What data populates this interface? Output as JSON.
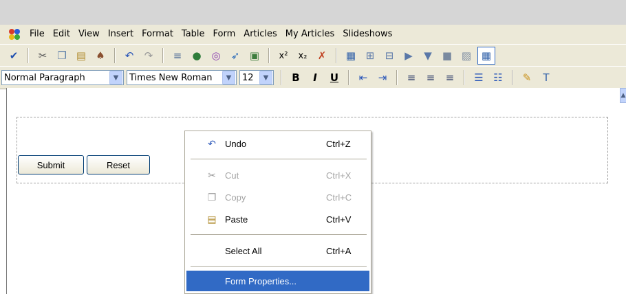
{
  "menu": {
    "items": [
      "File",
      "Edit",
      "View",
      "Insert",
      "Format",
      "Table",
      "Form",
      "Articles",
      "My Articles",
      "Slideshows"
    ]
  },
  "toolbar1": {
    "icons": [
      {
        "name": "spellcheck-icon",
        "glyph": "✔",
        "color": "#2050b0"
      },
      {
        "sep": true
      },
      {
        "name": "cut-icon",
        "glyph": "✂",
        "color": "#555555"
      },
      {
        "name": "copy-icon",
        "glyph": "❐",
        "color": "#5a7da8"
      },
      {
        "name": "paste-icon",
        "glyph": "▤",
        "color": "#b08a2c"
      },
      {
        "name": "find-icon",
        "glyph": "♠",
        "color": "#8a5030"
      },
      {
        "sep": true
      },
      {
        "name": "undo-icon",
        "glyph": "↶",
        "color": "#2a56b8"
      },
      {
        "name": "redo-icon",
        "glyph": "↷",
        "color": "#9a9a9a"
      },
      {
        "sep": true
      },
      {
        "name": "horizontal-rule-icon",
        "glyph": "≡",
        "color": "#406090"
      },
      {
        "name": "insert-link-icon",
        "glyph": "●",
        "color": "#2f7d3a"
      },
      {
        "name": "insert-media-icon",
        "glyph": "◎",
        "color": "#8a3ab0"
      },
      {
        "name": "insert-bookmark-icon",
        "glyph": "➶",
        "color": "#2a6ab8"
      },
      {
        "name": "insert-image-icon",
        "glyph": "▣",
        "color": "#3d7d3d"
      },
      {
        "sep": true
      },
      {
        "name": "superscript-icon",
        "glyph": "x²",
        "color": "#000000"
      },
      {
        "name": "subscript-icon",
        "glyph": "x₂",
        "color": "#000000"
      },
      {
        "name": "clear-formatting-icon",
        "glyph": "✗",
        "color": "#c04020"
      },
      {
        "sep": true
      },
      {
        "name": "insert-table-icon",
        "glyph": "▦",
        "color": "#3060a8"
      },
      {
        "name": "insert-row-icon",
        "glyph": "⊞",
        "color": "#5a78a8"
      },
      {
        "name": "insert-column-icon",
        "glyph": "⊟",
        "color": "#5a78a8"
      },
      {
        "name": "merge-cells-icon",
        "glyph": "▶",
        "color": "#5a78a8"
      },
      {
        "name": "split-cells-icon",
        "glyph": "▼",
        "color": "#5a78a8"
      },
      {
        "name": "delete-row-icon",
        "glyph": "■",
        "color": "#7a8aa0"
      },
      {
        "name": "table-properties-icon",
        "glyph": "▨",
        "color": "#7a8aa0"
      },
      {
        "name": "show-borders-icon",
        "glyph": "▦",
        "color": "#3060a8"
      }
    ]
  },
  "toolbar2": {
    "paragraph_style": "Normal Paragraph",
    "font_family": "Times New Roman",
    "font_size": "12",
    "icons": [
      {
        "name": "bold-icon",
        "glyph": "B",
        "color": "#000000"
      },
      {
        "name": "italic-icon",
        "glyph": "I",
        "color": "#000000"
      },
      {
        "name": "underline-icon",
        "glyph": "U",
        "color": "#000000"
      },
      {
        "sep": true
      },
      {
        "name": "outdent-icon",
        "glyph": "⇤",
        "color": "#2a56b8"
      },
      {
        "name": "indent-icon",
        "glyph": "⇥",
        "color": "#2a56b8"
      },
      {
        "sep": true
      },
      {
        "name": "align-left-icon",
        "glyph": "≡",
        "color": "#203060"
      },
      {
        "name": "align-center-icon",
        "glyph": "≡",
        "color": "#203060"
      },
      {
        "name": "align-right-icon",
        "glyph": "≡",
        "color": "#203060"
      },
      {
        "sep": true
      },
      {
        "name": "bulleted-list-icon",
        "glyph": "☰",
        "color": "#2a56b8"
      },
      {
        "name": "numbered-list-icon",
        "glyph": "☷",
        "color": "#2a56b8"
      },
      {
        "sep": true
      },
      {
        "name": "highlight-color-icon",
        "glyph": "✎",
        "color": "#c89018"
      },
      {
        "name": "text-color-icon",
        "glyph": "T",
        "color": "#3060a8"
      }
    ]
  },
  "form": {
    "submit_label": "Submit",
    "reset_label": "Reset"
  },
  "context_menu": {
    "undo": {
      "label": "Undo",
      "shortcut": "Ctrl+Z"
    },
    "cut": {
      "label": "Cut",
      "shortcut": "Ctrl+X"
    },
    "copy": {
      "label": "Copy",
      "shortcut": "Ctrl+C"
    },
    "paste": {
      "label": "Paste",
      "shortcut": "Ctrl+V"
    },
    "select_all": {
      "label": "Select All",
      "shortcut": "Ctrl+A"
    },
    "form_properties": {
      "label": "Form Properties..."
    }
  },
  "colors": {
    "selection": "#316ac5",
    "toolbar_bg": "#ece9d8"
  }
}
